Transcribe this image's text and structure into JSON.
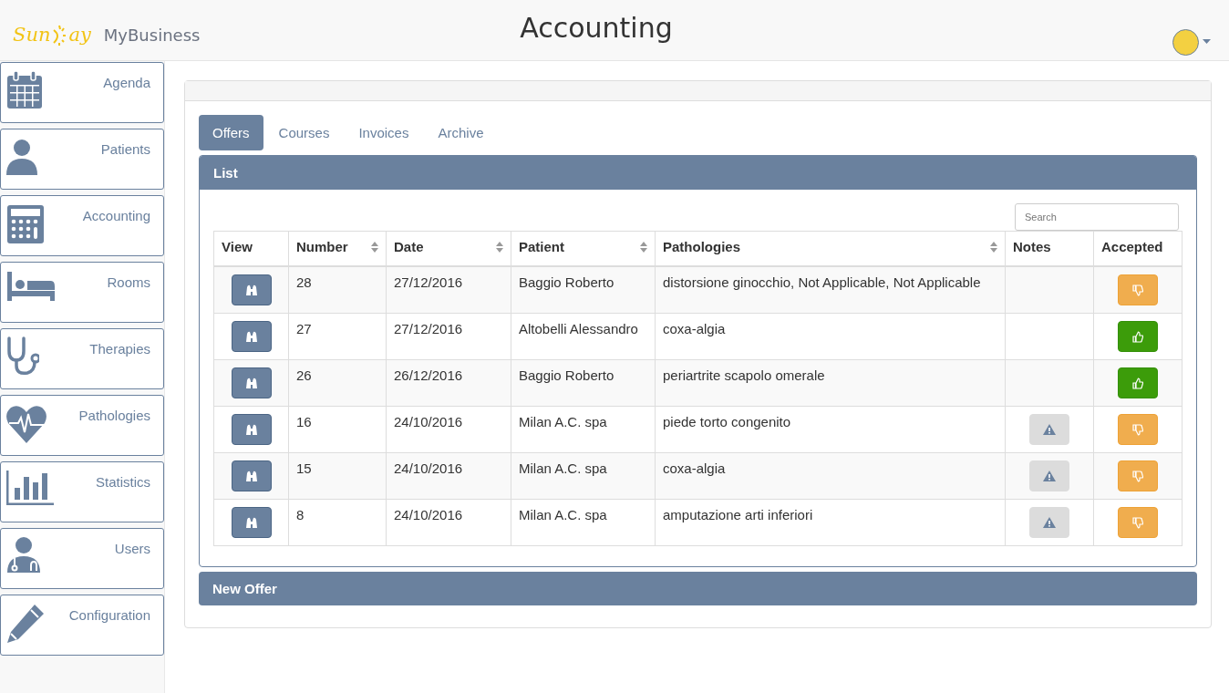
{
  "header": {
    "logo_left": "Sun",
    "logo_right": "ay",
    "app_name": "MyBusiness",
    "title": "Accounting"
  },
  "sidebar": {
    "items": [
      {
        "label": "Agenda"
      },
      {
        "label": "Patients"
      },
      {
        "label": "Accounting"
      },
      {
        "label": "Rooms"
      },
      {
        "label": "Therapies"
      },
      {
        "label": "Pathologies"
      },
      {
        "label": "Statistics"
      },
      {
        "label": "Users"
      },
      {
        "label": "Configuration"
      }
    ]
  },
  "tabs": [
    {
      "label": "Offers",
      "selected": true
    },
    {
      "label": "Courses",
      "selected": false
    },
    {
      "label": "Invoices",
      "selected": false
    },
    {
      "label": "Archive",
      "selected": false
    }
  ],
  "list_panel": {
    "title": "List",
    "search": {
      "placeholder": "Search"
    },
    "table": {
      "columns": [
        {
          "label": "View",
          "sortable": false
        },
        {
          "label": "Number",
          "sortable": true
        },
        {
          "label": "Date",
          "sortable": true
        },
        {
          "label": "Patient",
          "sortable": true
        },
        {
          "label": "Pathologies",
          "sortable": true
        },
        {
          "label": "Notes",
          "sortable": false
        },
        {
          "label": "Accepted",
          "sortable": false
        }
      ],
      "rows": [
        {
          "number": "28",
          "date": "27/12/2016",
          "patient": "Baggio Roberto",
          "pathologies": "distorsione ginocchio, Not Applicable, Not Applicable",
          "has_notes": false,
          "accepted": false
        },
        {
          "number": "27",
          "date": "27/12/2016",
          "patient": "Altobelli Alessandro",
          "pathologies": "coxa-algia",
          "has_notes": false,
          "accepted": true
        },
        {
          "number": "26",
          "date": "26/12/2016",
          "patient": "Baggio Roberto",
          "pathologies": "periartrite scapolo omerale",
          "has_notes": false,
          "accepted": true
        },
        {
          "number": "16",
          "date": "24/10/2016",
          "patient": "Milan A.C. spa",
          "pathologies": "piede torto congenito",
          "has_notes": true,
          "accepted": false
        },
        {
          "number": "15",
          "date": "24/10/2016",
          "patient": "Milan A.C. spa",
          "pathologies": "coxa-algia",
          "has_notes": true,
          "accepted": false
        },
        {
          "number": "8",
          "date": "24/10/2016",
          "patient": "Milan A.C. spa",
          "pathologies": "amputazione arti inferiori",
          "has_notes": true,
          "accepted": false
        }
      ]
    }
  },
  "new_panel": {
    "title": "New Offer"
  }
}
